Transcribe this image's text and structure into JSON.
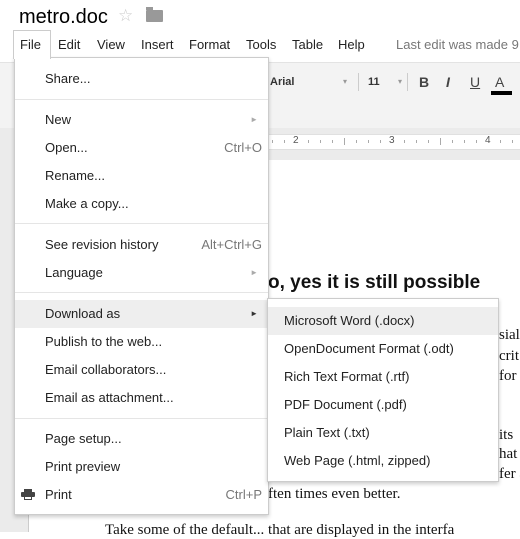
{
  "doc": {
    "title": "metro.doc",
    "star_icon": "star-icon",
    "folder_icon": "folder-icon"
  },
  "menubar": {
    "items": [
      "File",
      "Edit",
      "View",
      "Insert",
      "Format",
      "Tools",
      "Table",
      "Help"
    ],
    "last_edit": "Last edit was made 9"
  },
  "toolbar": {
    "font": "Arial",
    "font_size": "11",
    "bold": "B",
    "italic": "I",
    "underline": "U",
    "text_color": "A",
    "dropdown_glyph": "▾"
  },
  "ruler": {
    "labels": [
      "2",
      "3",
      "4"
    ]
  },
  "document": {
    "heading": "o, yes it is still possible",
    "lines": [
      "sial",
      "crit",
      "for",
      "its",
      "hat",
      "fer a",
      "ften times even better.",
      "Take some of the default... that are displayed in the interfa"
    ]
  },
  "file_menu": {
    "items": [
      {
        "label": "Share...",
        "shortcut": "",
        "submenu": false
      },
      {
        "label": "New",
        "shortcut": "",
        "submenu": true
      },
      {
        "label": "Open...",
        "shortcut": "Ctrl+O",
        "submenu": false
      },
      {
        "label": "Rename...",
        "shortcut": "",
        "submenu": false
      },
      {
        "label": "Make a copy...",
        "shortcut": "",
        "submenu": false
      },
      {
        "label": "See revision history",
        "shortcut": "Alt+Ctrl+G",
        "submenu": false
      },
      {
        "label": "Language",
        "shortcut": "",
        "submenu": true
      },
      {
        "label": "Download as",
        "shortcut": "",
        "submenu": true,
        "highlighted": true
      },
      {
        "label": "Publish to the web...",
        "shortcut": "",
        "submenu": false
      },
      {
        "label": "Email collaborators...",
        "shortcut": "",
        "submenu": false
      },
      {
        "label": "Email as attachment...",
        "shortcut": "",
        "submenu": false
      },
      {
        "label": "Page setup...",
        "shortcut": "",
        "submenu": false
      },
      {
        "label": "Print preview",
        "shortcut": "",
        "submenu": false
      },
      {
        "label": "Print",
        "shortcut": "Ctrl+P",
        "submenu": false,
        "icon": "printer-icon"
      }
    ],
    "submenu_arrow": "►"
  },
  "download_submenu": {
    "items": [
      "Microsoft Word (.docx)",
      "OpenDocument Format (.odt)",
      "Rich Text Format (.rtf)",
      "PDF Document (.pdf)",
      "Plain Text (.txt)",
      "Web Page (.html, zipped)"
    ],
    "highlighted_index": 0
  }
}
